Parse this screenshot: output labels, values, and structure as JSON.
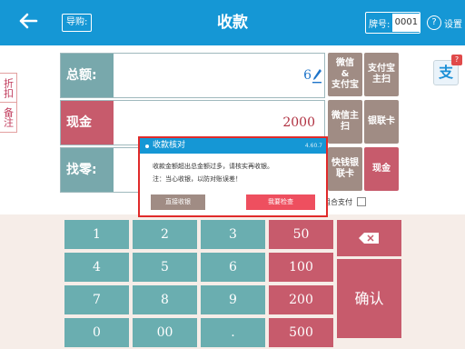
{
  "header": {
    "back_icon": "back-arrow-icon",
    "guide_label": "导购:",
    "title": "收款",
    "plate_label": "牌号:",
    "plate_value": "0001",
    "settings_icon": "question-circle-icon",
    "settings_label": "设置",
    "color": "#1597d5"
  },
  "side_tabs": [
    "折扣",
    "备注"
  ],
  "fields": {
    "total": {
      "label": "总额:",
      "value": "6",
      "icon": "pencil-icon"
    },
    "cash": {
      "label": "现金",
      "value": "2000"
    },
    "change": {
      "label": "找零:",
      "value": ""
    }
  },
  "payment_buttons": {
    "wechat_pay": "微信\n&\n支付宝",
    "alipay_scan": "支付宝\n主扫",
    "wechat_scan": "微信主\n扫",
    "unionpay": "银联卡",
    "quickpay": "快钱银\n联卡",
    "cash": "现金"
  },
  "combo_pay_label": "组合支付",
  "alipay_badge": {
    "glyph": "支",
    "badge": "?"
  },
  "dialog": {
    "title": "收款核对",
    "version": "4.60.7",
    "message_1": "收款金额超出总金额过多，请核实再收银。",
    "message_2": "注：当心收银，以防对账误差！",
    "button_direct": "直接收银",
    "button_check": "我要检查"
  },
  "keypad": {
    "digits": [
      "1",
      "2",
      "3",
      "4",
      "5",
      "6",
      "7",
      "8",
      "9",
      "0",
      "00",
      "."
    ],
    "quick_amounts": [
      "50",
      "100",
      "200",
      "500"
    ],
    "backspace_icon": "backspace-icon",
    "confirm_label": "确认"
  },
  "colors": {
    "teal": "#6aaeb0",
    "red": "#c75b6c",
    "brown": "#a08c84",
    "blue": "#1597d5"
  }
}
